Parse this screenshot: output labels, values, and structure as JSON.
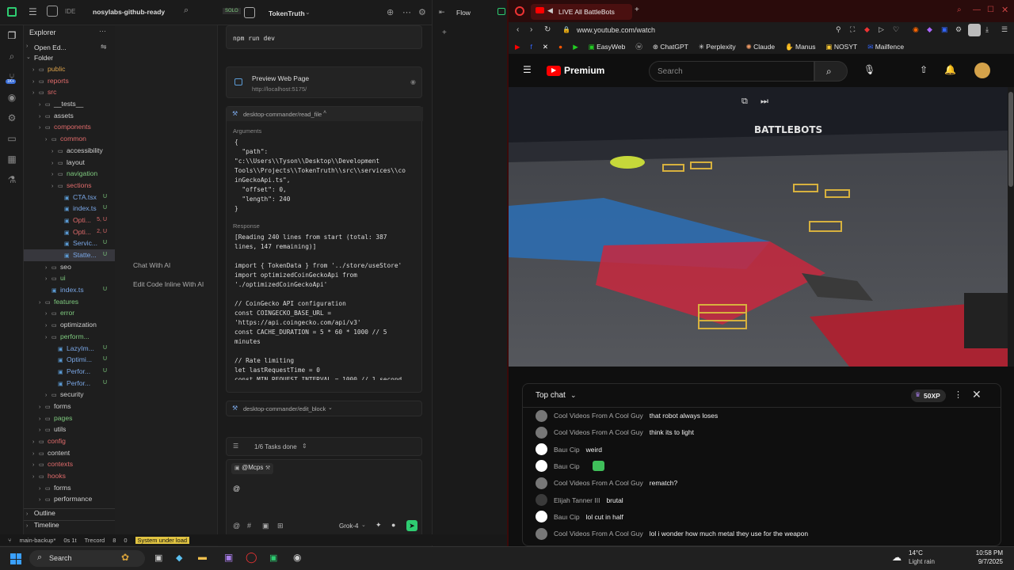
{
  "ide": {
    "app_label": "IDE",
    "project": "nosylabs-github-ready",
    "chat_tab": "TokenTruth",
    "right_tab": "Flow",
    "explorer_title": "Explorer",
    "open_editors": "Open Ed...",
    "folder": "Folder",
    "tree": [
      {
        "label": "public",
        "depth": 1,
        "kind": "folder",
        "badge": "",
        "color": "#d9a04a"
      },
      {
        "label": "reports",
        "depth": 1,
        "kind": "folder",
        "badge": "",
        "color": "#e06b6b"
      },
      {
        "label": "src",
        "depth": 1,
        "kind": "folder",
        "badge": "",
        "color": "#e06b6b"
      },
      {
        "label": "__tests__",
        "depth": 2,
        "kind": "folder",
        "badge": "",
        "color": "#cfcfcf"
      },
      {
        "label": "assets",
        "depth": 2,
        "kind": "folder",
        "badge": "",
        "color": "#cfcfcf"
      },
      {
        "label": "components",
        "depth": 2,
        "kind": "folder",
        "badge": "",
        "color": "#e06b6b"
      },
      {
        "label": "common",
        "depth": 3,
        "kind": "folder",
        "badge": "",
        "color": "#e06b6b"
      },
      {
        "label": "accessibility",
        "depth": 4,
        "kind": "folder",
        "badge": "",
        "color": "#cfcfcf"
      },
      {
        "label": "layout",
        "depth": 4,
        "kind": "folder",
        "badge": "",
        "color": "#cfcfcf"
      },
      {
        "label": "navigation",
        "depth": 4,
        "kind": "folder",
        "badge": "",
        "color": "#7ec97e"
      },
      {
        "label": "sections",
        "depth": 4,
        "kind": "folder",
        "badge": "",
        "color": "#e06b6b"
      },
      {
        "label": "CTA.tsx",
        "depth": 5,
        "kind": "file",
        "badge": "U",
        "color": "#7aa7e6"
      },
      {
        "label": "index.ts",
        "depth": 5,
        "kind": "file",
        "badge": "U",
        "color": "#7aa7e6"
      },
      {
        "label": "Opti...",
        "depth": 5,
        "kind": "file",
        "badge": "5, U",
        "color": "#e06b6b"
      },
      {
        "label": "Opti...",
        "depth": 5,
        "kind": "file",
        "badge": "2, U",
        "color": "#e06b6b"
      },
      {
        "label": "Servic...",
        "depth": 5,
        "kind": "file",
        "badge": "U",
        "color": "#7aa7e6"
      },
      {
        "label": "Statte...",
        "depth": 5,
        "kind": "file",
        "badge": "U",
        "color": "#7aa7e6"
      },
      {
        "label": "seo",
        "depth": 3,
        "kind": "folder",
        "badge": "",
        "color": "#cfcfcf"
      },
      {
        "label": "ui",
        "depth": 3,
        "kind": "folder",
        "badge": "",
        "color": "#7ec97e"
      },
      {
        "label": "index.ts",
        "depth": 3,
        "kind": "file",
        "badge": "U",
        "color": "#7aa7e6"
      },
      {
        "label": "features",
        "depth": 2,
        "kind": "folder",
        "badge": "",
        "color": "#7ec97e"
      },
      {
        "label": "error",
        "depth": 3,
        "kind": "folder",
        "badge": "",
        "color": "#7ec97e"
      },
      {
        "label": "optimization",
        "depth": 3,
        "kind": "folder",
        "badge": "",
        "color": "#cfcfcf"
      },
      {
        "label": "perform...",
        "depth": 3,
        "kind": "folder",
        "badge": "",
        "color": "#7ec97e"
      },
      {
        "label": "LazyIm...",
        "depth": 4,
        "kind": "file",
        "badge": "U",
        "color": "#7aa7e6"
      },
      {
        "label": "Optimi...",
        "depth": 4,
        "kind": "file",
        "badge": "U",
        "color": "#7aa7e6"
      },
      {
        "label": "Perfor...",
        "depth": 4,
        "kind": "file",
        "badge": "U",
        "color": "#7aa7e6"
      },
      {
        "label": "Perfor...",
        "depth": 4,
        "kind": "file",
        "badge": "U",
        "color": "#7aa7e6"
      },
      {
        "label": "security",
        "depth": 3,
        "kind": "folder",
        "badge": "",
        "color": "#cfcfcf"
      },
      {
        "label": "forms",
        "depth": 2,
        "kind": "folder",
        "badge": "",
        "color": "#cfcfcf"
      },
      {
        "label": "pages",
        "depth": 2,
        "kind": "folder",
        "badge": "",
        "color": "#7ec97e"
      },
      {
        "label": "utils",
        "depth": 2,
        "kind": "folder",
        "badge": "",
        "color": "#cfcfcf"
      },
      {
        "label": "config",
        "depth": 1,
        "kind": "folder",
        "badge": "",
        "color": "#e06b6b"
      },
      {
        "label": "content",
        "depth": 1,
        "kind": "folder",
        "badge": "",
        "color": "#cfcfcf"
      },
      {
        "label": "contexts",
        "depth": 1,
        "kind": "folder",
        "badge": "",
        "color": "#e06b6b"
      },
      {
        "label": "hooks",
        "depth": 1,
        "kind": "folder",
        "badge": "",
        "color": "#e06b6b"
      },
      {
        "label": "forms",
        "depth": 2,
        "kind": "folder",
        "badge": "",
        "color": "#cfcfcf"
      },
      {
        "label": "performance",
        "depth": 2,
        "kind": "folder",
        "badge": "",
        "color": "#cfcfcf"
      }
    ],
    "outline": "Outline",
    "timeline": "Timeline",
    "mid_links": [
      "Chat With AI",
      "Edit Code Inline With AI"
    ],
    "cmd": "npm run dev",
    "preview_title": "Preview Web Page",
    "preview_url": "http://localhost:5175/",
    "tool1": "desktop-commander/read_file",
    "arguments_label": "Arguments",
    "args_code": "{\n  \"path\":\n\"c:\\\\Users\\\\Tyson\\\\Desktop\\\\Development\nTools\\\\Projects\\\\TokenTruth\\\\src\\\\services\\\\co\ninGeckoApi.ts\",\n  \"offset\": 0,\n  \"length\": 240\n}",
    "response_label": "Response",
    "resp_code": "[Reading 240 lines from start (total: 387\nlines, 147 remaining)]\n\nimport { TokenData } from '../store/useStore'\nimport optimizedCoinGeckoApi from\n'./optimizedCoinGeckoApi'\n\n// CoinGecko API configuration\nconst COINGECKO_BASE_URL =\n'https://api.coingecko.com/api/v3'\nconst CACHE_DURATION = 5 * 60 * 1000 // 5\nminutes\n\n// Rate limiting\nlet lastRequestTime = 0\nconst MIN_REQUEST_INTERVAL = 1000 // 1 second",
    "tool2": "desktop-commander/edit_block",
    "tasks": "1/6 Tasks done",
    "mention": "@Mcps",
    "input_value": "@",
    "model": "Grok-4",
    "status": {
      "branch": "main-backup*",
      "time": "0s 1t",
      "trecord": "Trecord",
      "counts": "8",
      "warn": "0",
      "load": "System under load"
    },
    "solo": "SOLO"
  },
  "browser": {
    "tab_title": "LIVE All BattleBots",
    "url": "www.youtube.com/watch",
    "bookmarks": [
      "EasyWeb",
      "ChatGPT",
      "Perplexity",
      "Claude",
      "Manus",
      "NOSYT",
      "Mailfence"
    ],
    "yt_logo": "Premium",
    "search_placeholder": "Search",
    "video_sign": "BATTLEBOTS",
    "chat_mode": "Top chat",
    "xp": "50XP",
    "messages": [
      {
        "author": "Cool Videos From A Cool Guy",
        "text": "that robot always loses",
        "avatar": "#777777"
      },
      {
        "author": "Cool Videos From A Cool Guy",
        "text": "think its to light",
        "avatar": "#777777"
      },
      {
        "author": "Bauı Cip",
        "text": "weird",
        "avatar": "#ffffff"
      },
      {
        "author": "Bauı Cip",
        "text": "",
        "avatar": "#ffffff",
        "emoji": true
      },
      {
        "author": "Cool Videos From A Cool Guy",
        "text": "rematch?",
        "avatar": "#777777"
      },
      {
        "author": "Elijah Tanner III",
        "text": "brutal",
        "avatar": "#3a3a3a"
      },
      {
        "author": "Bauı Cip",
        "text": "lol cut in half",
        "avatar": "#ffffff"
      },
      {
        "author": "Cool Videos From A Cool Guy",
        "text": "lol i wonder how much metal they use for the weapon",
        "avatar": "#777777"
      }
    ]
  },
  "taskbar": {
    "search": "Search",
    "weather_temp": "14°C",
    "weather_desc": "Light rain",
    "time": "10:58 PM",
    "date": "9/7/2025"
  }
}
